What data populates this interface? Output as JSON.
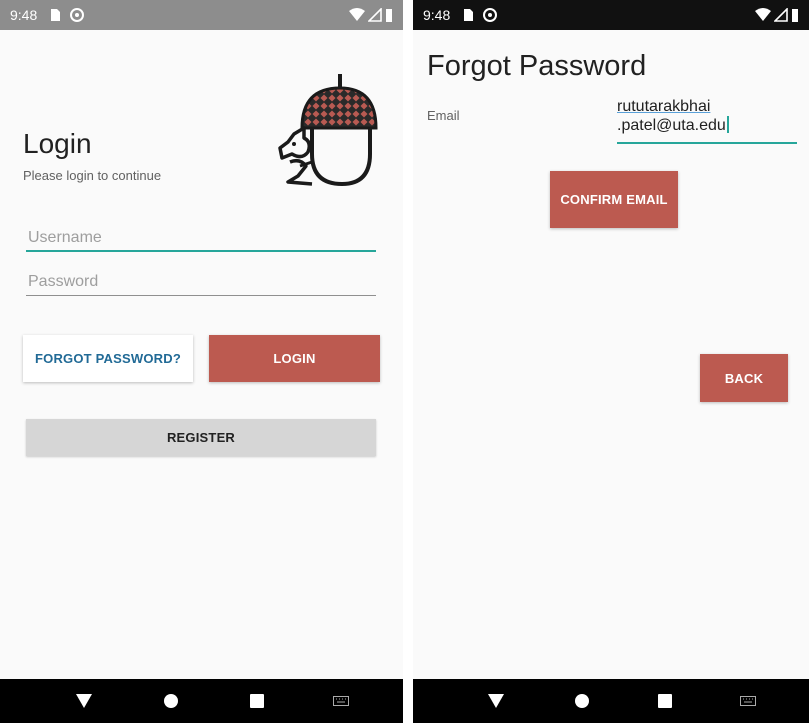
{
  "login_screen": {
    "status": {
      "time": "9:48"
    },
    "title": "Login",
    "subtitle": "Please login to continue",
    "username": {
      "placeholder": "Username"
    },
    "password": {
      "placeholder": "Password"
    },
    "forgot_label": "FORGOT PASSWORD?",
    "login_label": "LOGIN",
    "register_label": "REGISTER"
  },
  "forgot_screen": {
    "status": {
      "time": "9:48"
    },
    "title": "Forgot Password",
    "email_label": "Email",
    "email_value_line1": "rututarakbhai",
    "email_value_line2": ".patel@uta.edu",
    "confirm_label": "CONFIRM EMAIL",
    "back_label": "BACK"
  },
  "colors": {
    "accent": "#bc5a50",
    "underline_active": "#26a69a",
    "link_blue": "#216a96"
  },
  "icons": [
    "sd-card-icon",
    "sync-icon",
    "wifi-icon",
    "signal-icon",
    "battery-icon",
    "back-nav-icon",
    "home-nav-icon",
    "recents-nav-icon",
    "keyboard-icon",
    "acorn-squirrel-logo"
  ]
}
